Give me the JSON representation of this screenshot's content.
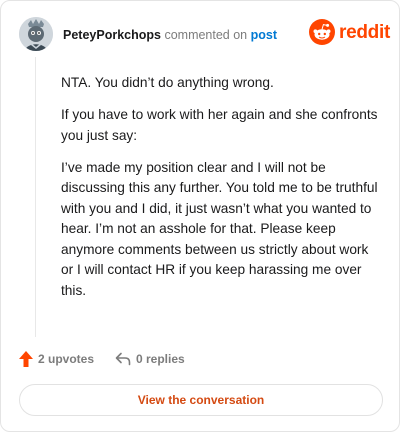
{
  "header": {
    "username": "PeteyPorkchops",
    "verb": "commented on",
    "post_link": "post",
    "logo_text": "reddit"
  },
  "comment": {
    "paragraphs": [
      "NTA. You didn’t do anything wrong.",
      "If you have to work with her again and she confronts you just say:",
      "I’ve made my position clear and I will not be discussing this any further. You told me to be truthful with you and I did, it just wasn’t what you wanted to hear. I’m not an asshole for that. Please keep anymore comments between us strictly about work or I will contact HR if you keep harassing me over this."
    ]
  },
  "actions": {
    "upvotes_label": "2 upvotes",
    "replies_label": "0 replies"
  },
  "footer": {
    "view_button_label": "View the conversation"
  },
  "icons": {
    "upvote": "upvote-arrow-icon",
    "reply": "reply-arrow-icon",
    "logo": "reddit-snoo-icon",
    "avatar": "user-avatar"
  },
  "colors": {
    "brand": "#ff4500",
    "link": "#0079d3",
    "upvote": "#ff4500",
    "button_text": "#d44a12",
    "muted": "#7c7c7c"
  }
}
